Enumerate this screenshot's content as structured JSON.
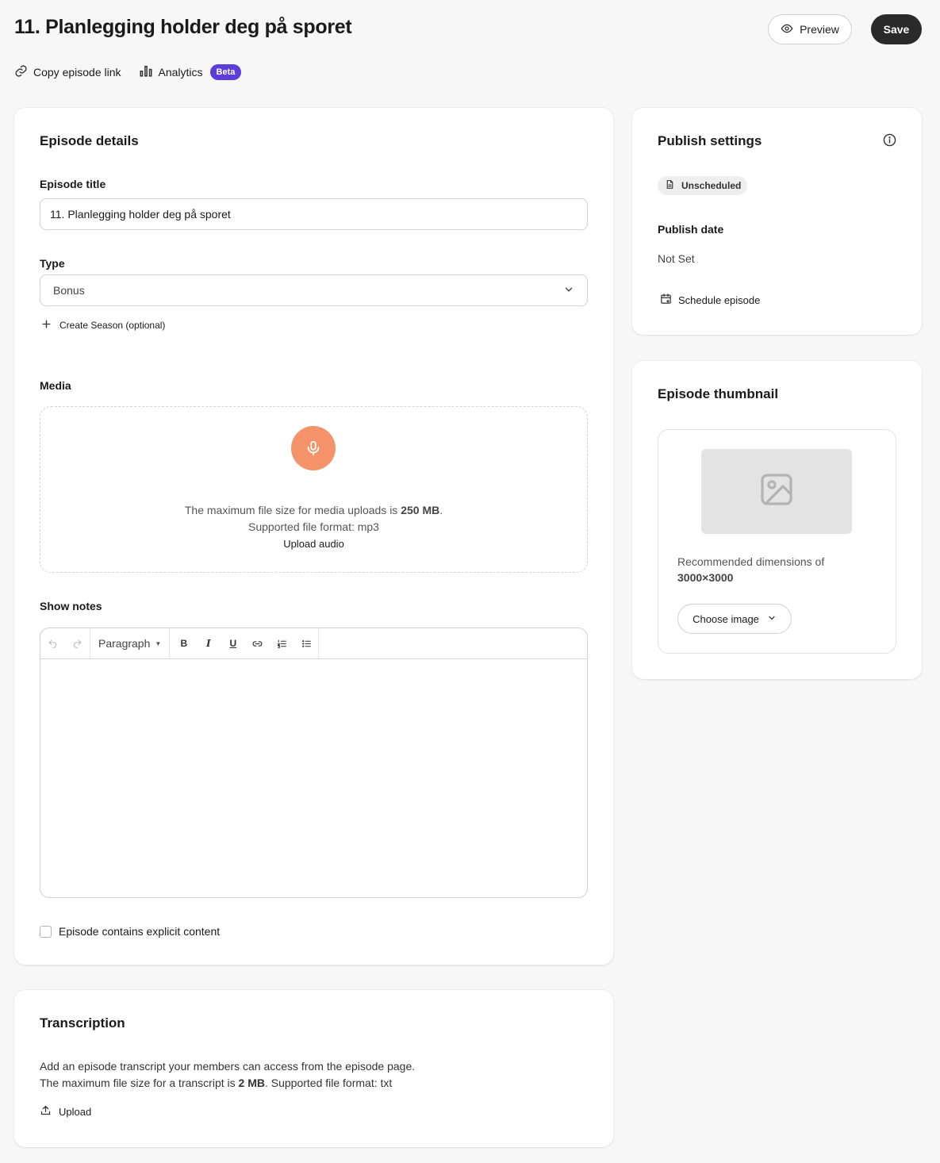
{
  "header": {
    "title": "11. Planlegging holder deg på sporet",
    "preview_label": "Preview",
    "save_label": "Save"
  },
  "subnav": {
    "copy_link_label": "Copy episode link",
    "analytics_label": "Analytics",
    "beta_label": "Beta"
  },
  "episode_details": {
    "title": "Episode details",
    "episode_title_label": "Episode title",
    "episode_title_value": "11. Planlegging holder deg på sporet",
    "type_label": "Type",
    "type_value": "Bonus",
    "create_season_label": "Create Season (optional)",
    "media_label": "Media",
    "media_max_prefix": "The maximum file size for media uploads is ",
    "media_max_size": "250 MB",
    "media_max_suffix": ".",
    "media_format": "Supported file format: mp3",
    "upload_audio_label": "Upload audio",
    "show_notes_label": "Show notes",
    "paragraph_label": "Paragraph",
    "explicit_label": "Episode contains explicit content"
  },
  "transcription": {
    "title": "Transcription",
    "line1": "Add an episode transcript your members can access from the episode page.",
    "line2_prefix": "The maximum file size for a transcript is ",
    "line2_size": "2 MB",
    "line2_suffix": ". Supported file format: txt",
    "upload_label": "Upload"
  },
  "publish_settings": {
    "title": "Publish settings",
    "status_badge": "Unscheduled",
    "publish_date_label": "Publish date",
    "publish_date_value": "Not Set",
    "schedule_label": "Schedule episode"
  },
  "thumbnail": {
    "title": "Episode thumbnail",
    "rec_line1": "Recommended dimensions of",
    "rec_line2": "3000×3000",
    "choose_label": "Choose image"
  },
  "colors": {
    "background": "#f7f7f7",
    "save_button": "#2a2a2a",
    "beta_badge": "#5b3ddb",
    "mic_accent": "#f4936a"
  }
}
